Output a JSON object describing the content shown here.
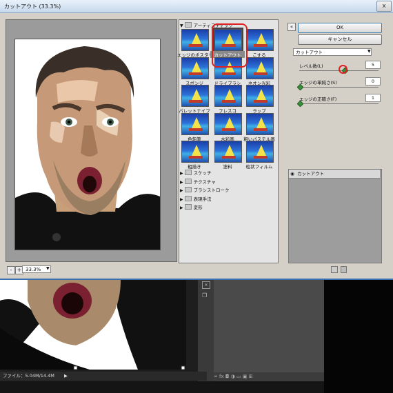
{
  "window": {
    "title": "カットアウト (33.3%)",
    "close_label": "x"
  },
  "preview": {
    "zoom": "33.3%",
    "zoom_out": "-",
    "zoom_in": "+"
  },
  "gallery": {
    "group_name": "アーティスティック",
    "filters": [
      {
        "label": "エッジのポスタリゼーション",
        "selected": false
      },
      {
        "label": "カットアウト",
        "selected": true
      },
      {
        "label": "こする",
        "selected": false
      },
      {
        "label": "スポンジ",
        "selected": false
      },
      {
        "label": "ドライブラシ",
        "selected": false
      },
      {
        "label": "ネオン光彩",
        "selected": false
      },
      {
        "label": "パレットナイフ",
        "selected": false
      },
      {
        "label": "フレスコ",
        "selected": false
      },
      {
        "label": "ラップ",
        "selected": false
      },
      {
        "label": "色鉛筆",
        "selected": false
      },
      {
        "label": "水彩画",
        "selected": false
      },
      {
        "label": "粗いパステル画",
        "selected": false
      },
      {
        "label": "粗描き",
        "selected": false
      },
      {
        "label": "塗料",
        "selected": false
      },
      {
        "label": "粒状フィルム",
        "selected": false
      }
    ],
    "categories": [
      "スケッチ",
      "テクスチャ",
      "ブラシストローク",
      "表現手法",
      "変形"
    ]
  },
  "buttons": {
    "ok": "OK",
    "cancel": "キャンセル",
    "collapse": "«"
  },
  "settings": {
    "filter_name": "カットアウト",
    "params": [
      {
        "label": "レベル数(L)",
        "value": "5",
        "level": 0.5
      },
      {
        "label": "エッジの単純さ(S)",
        "value": "0",
        "level": 0.0
      },
      {
        "label": "エッジの正確さ(F)",
        "value": "1",
        "level": 0.0
      }
    ]
  },
  "layers": {
    "item": "カットアウト"
  },
  "status": {
    "file_info": "ファイル：5.04M/14.4M",
    "arrow": "▶"
  },
  "panel_footer": "∞ fx ◘ ◑ ▭ ▣ ⊞",
  "colors": {
    "accent_red": "#e02020",
    "dialog_bg": "#d4d0c8",
    "ps_dark": "#3a3a3a"
  }
}
